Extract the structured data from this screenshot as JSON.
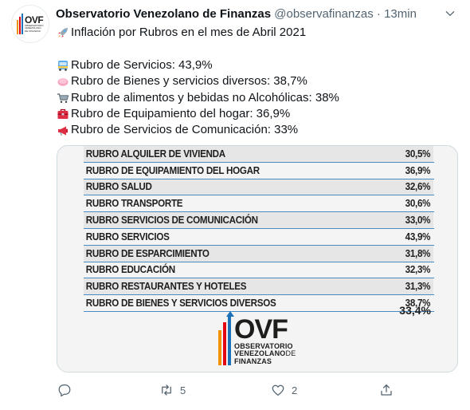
{
  "tweet": {
    "author_name": "Observatorio Venezolano de Finanzas",
    "author_handle": "@observafinanzas",
    "separator": "·",
    "time": "13min",
    "lines": [
      {
        "icon": "rocket-icon",
        "text": "Inflación por Rubros en el mes de Abril 2021"
      },
      {
        "icon": "",
        "text": ""
      },
      {
        "icon": "bus-icon",
        "text": "Rubro de Servicios: 43,9%"
      },
      {
        "icon": "soap-icon",
        "text": "Rubro de Bienes y servicios diversos: 38,7%"
      },
      {
        "icon": "shopping-cart-icon",
        "text": "Rubro de alimentos y bebidas no Alcohólicas: 38%"
      },
      {
        "icon": "toolbox-icon",
        "text": "Rubro de Equipamiento del hogar: 36,9%"
      },
      {
        "icon": "megaphone-icon",
        "text": "Rubro de Servicios de Comunicación: 33%"
      }
    ]
  },
  "avatar": {
    "brand": "OVF",
    "small": "OBSERVATORIO VENEZOLANO DE FINANZAS"
  },
  "media": {
    "rows": [
      {
        "label": "RUBRO ALQUILER DE VIVIENDA",
        "value": "30,5%"
      },
      {
        "label": "RUBRO DE EQUIPAMIENTO DEL HOGAR",
        "value": "36,9%"
      },
      {
        "label": "RUBRO SALUD",
        "value": "32,6%"
      },
      {
        "label": "RUBRO TRANSPORTE",
        "value": "30,6%"
      },
      {
        "label": "RUBRO SERVICIOS DE COMUNICACIÓN",
        "value": "33,0%"
      },
      {
        "label": "RUBRO SERVICIOS",
        "value": "43,9%"
      },
      {
        "label": "RUBRO DE ESPARCIMIENTO",
        "value": "31,8%"
      },
      {
        "label": "RUBRO EDUCACIÓN",
        "value": "32,3%"
      },
      {
        "label": "RUBRO RESTAURANTES Y HOTELES",
        "value": "31,3%"
      },
      {
        "label": "RUBRO DE BIENES Y SERVICIOS DIVERSOS",
        "value": "38,7%"
      }
    ],
    "total": "33,4%",
    "logo_big": "OVF",
    "logo_line1": "OBSERVATORIO",
    "logo_line2": "VENEZOLANO",
    "logo_line2_suffix": "DE",
    "logo_line3": "FINANZAS"
  },
  "actions": {
    "reply_count": "",
    "retweet_count": "5",
    "like_count": "2"
  },
  "colors": {
    "bar_orange": "#f29100",
    "bar_red": "#e30613",
    "bar_blue": "#1d71b8",
    "rule_blue": "#4a8ac4"
  }
}
